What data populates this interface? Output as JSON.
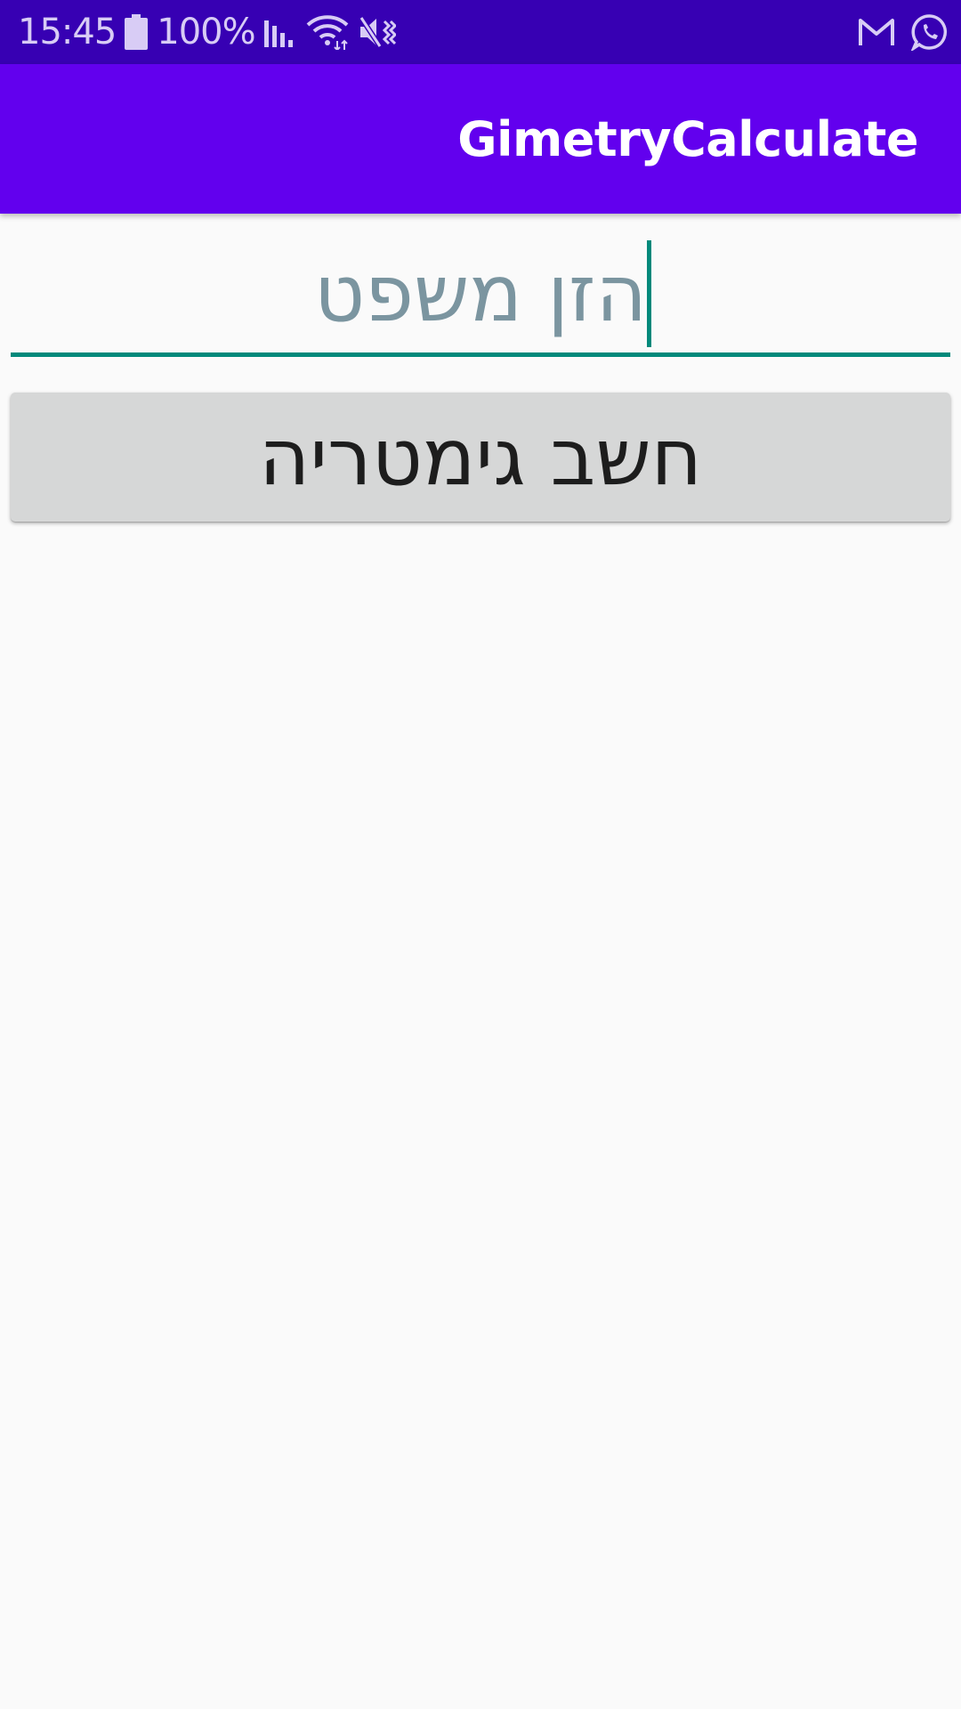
{
  "status_bar": {
    "time": "15:45",
    "battery_percent": "100%",
    "icons": [
      "battery-icon",
      "signal-icon",
      "wifi-icon",
      "mute-icon",
      "gmail-icon",
      "whatsapp-icon"
    ]
  },
  "app_bar": {
    "title": "GimetryCalculate",
    "color": "#6200EE"
  },
  "input": {
    "value": "",
    "placeholder": "הזן משפט",
    "accent_color": "#00897B"
  },
  "button": {
    "label": "חשב גימטריה"
  },
  "colors": {
    "status_bar": "#3700B3",
    "background": "#FAFAFA",
    "button": "#D6D7D7"
  }
}
